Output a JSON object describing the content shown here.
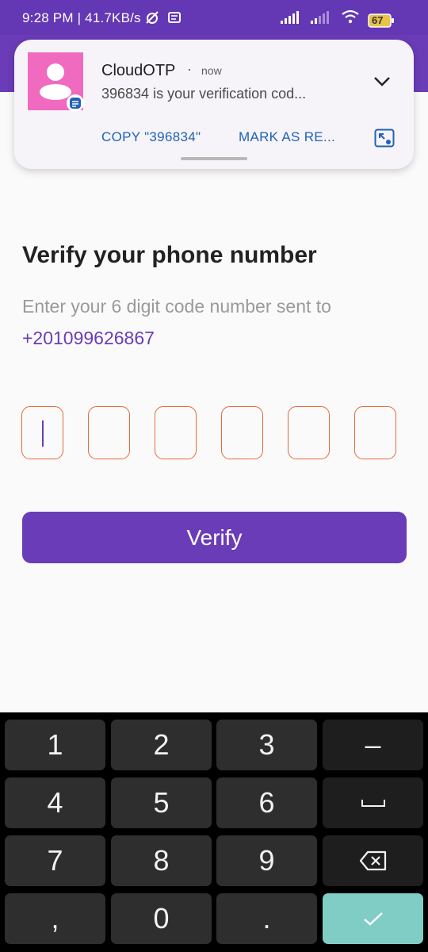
{
  "status_bar": {
    "time_speed": "9:28 PM | 41.7KB/s",
    "battery": "67"
  },
  "notification": {
    "app_name": "CloudOTP",
    "time": "now",
    "message": "396834 is your verification cod...",
    "actions": [
      "COPY \"396834\"",
      "MARK AS RE..."
    ]
  },
  "main": {
    "title": "Verify your phone number",
    "subtitle": "Enter your 6 digit code number sent to",
    "phone": "+201099626867",
    "otp_digits": [
      "",
      "",
      "",
      "",
      "",
      ""
    ],
    "verify_label": "Verify"
  },
  "keyboard": {
    "row1": [
      "1",
      "2",
      "3",
      "–"
    ],
    "row2": [
      "4",
      "5",
      "6"
    ],
    "row3": [
      "7",
      "8",
      "9"
    ],
    "row4": [
      ",",
      "0",
      "."
    ]
  },
  "colors": {
    "accent": "#6a3cb7",
    "otp_border": "#e56a3a",
    "enter_key": "#7fcdc4",
    "notification_link": "#1f62b8"
  }
}
